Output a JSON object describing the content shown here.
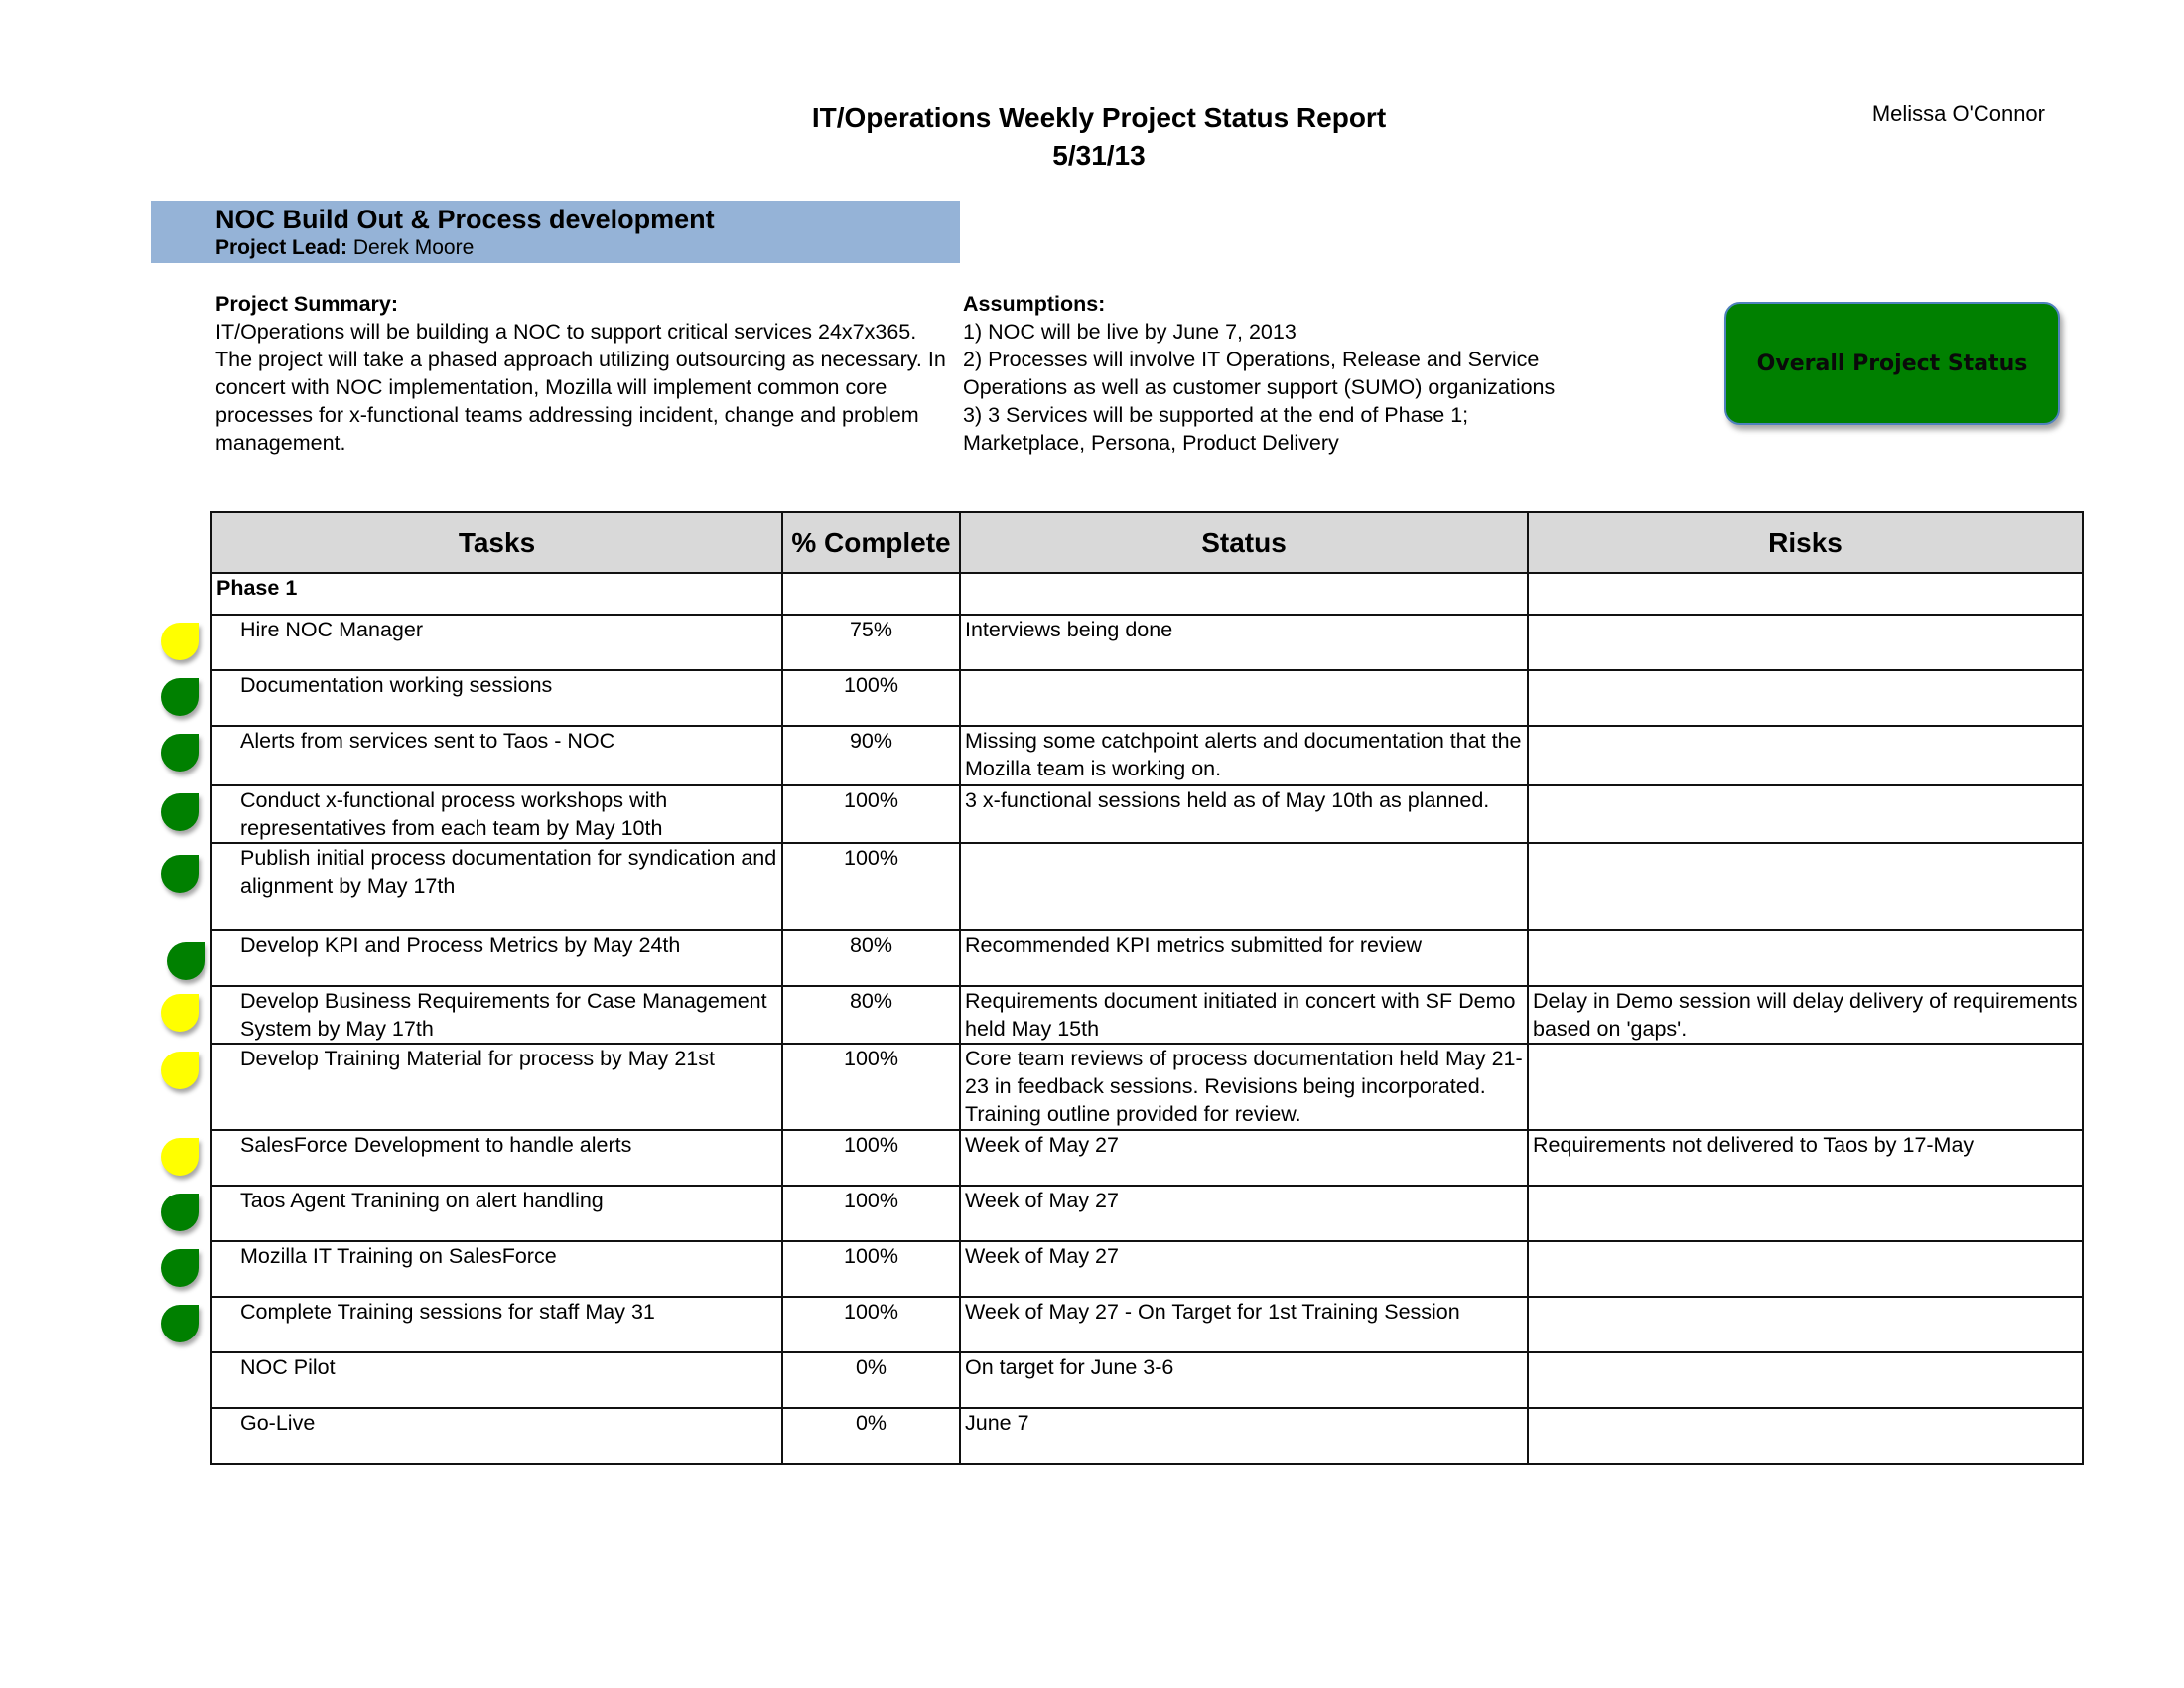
{
  "header": {
    "title": "IT/Operations Weekly Project Status Report",
    "date": "5/31/13",
    "author": "Melissa O'Connor"
  },
  "project": {
    "name": "NOC Build Out & Process development",
    "lead_label": "Project Lead:",
    "lead_name": "Derek Moore"
  },
  "summary": {
    "heading": "Project Summary:",
    "text": "IT/Operations will be building a NOC to support critical services 24x7x365. The project will take a phased approach utilizing outsourcing as necessary.  In concert with NOC implementation, Mozilla will implement common core processes for x-functional teams addressing incident, change and problem management."
  },
  "assumptions": {
    "heading": "Assumptions:",
    "items": [
      "1) NOC will be live by June 7, 2013",
      "2) Processes will involve IT Operations, Release and Service Operations as well as customer support (SUMO) organizations",
      "3) 3 Services will be supported at the end of Phase 1; Marketplace, Persona, Product Delivery"
    ]
  },
  "overall_status": {
    "label": "Overall Project Status",
    "color": "#008000"
  },
  "colors": {
    "green": "#008000",
    "yellow": "#ffff00",
    "header_bg": "#d9d9d9",
    "banner_bg": "#95b3d7"
  },
  "table": {
    "columns": [
      "Tasks",
      "% Complete",
      "Status",
      "Risks"
    ],
    "phase_label": "Phase 1",
    "rows": [
      {
        "task": "Hire NOC Manager",
        "pct": "75%",
        "status": "Interviews being done",
        "risk": "",
        "indicator": "yellow"
      },
      {
        "task": "Documentation working sessions",
        "pct": "100%",
        "status": "",
        "risk": "",
        "indicator": "green"
      },
      {
        "task": "Alerts from services sent to Taos - NOC",
        "pct": "90%",
        "status": "Missing some catchpoint alerts and documentation that the Mozilla team is working on.",
        "risk": "",
        "indicator": "green"
      },
      {
        "task": "Conduct x-functional process workshops with representatives from each team by May 10th",
        "pct": "100%",
        "status": "3 x-functional sessions held as of May 10th as planned.",
        "risk": "",
        "indicator": "green"
      },
      {
        "task": "Publish initial process documentation for syndication and alignment by May 17th",
        "pct": "100%",
        "status": "",
        "risk": "",
        "indicator": "green"
      },
      {
        "task": "Develop KPI and Process Metrics by May 24th",
        "pct": "80%",
        "status": "Recommended KPI metrics submitted for review",
        "risk": "",
        "indicator": "green"
      },
      {
        "task": "Develop Business Requirements for Case Management System by May 17th",
        "pct": "80%",
        "status": "Requirements document initiated in concert with SF Demo held May 15th",
        "risk": "Delay in Demo session will delay delivery of requirements based on 'gaps'.",
        "indicator": "yellow"
      },
      {
        "task": "Develop Training Material for process by May 21st",
        "pct": "100%",
        "status": "Core team reviews of process documentation held May 21-23 in feedback sessions. Revisions being incorporated. Training outline provided for review.",
        "risk": "",
        "indicator": "yellow"
      },
      {
        "task": "SalesForce Development to handle alerts",
        "pct": "100%",
        "status": "Week of May 27",
        "risk": "Requirements not delivered to Taos by 17-May",
        "indicator": "yellow"
      },
      {
        "task": "Taos Agent Tranining on alert handling",
        "pct": "100%",
        "status": "Week of May 27",
        "risk": "",
        "indicator": "green"
      },
      {
        "task": "Mozilla IT Training on SalesForce",
        "pct": "100%",
        "status": "Week of May 27",
        "risk": "",
        "indicator": "green"
      },
      {
        "task": "Complete Training sessions for staff May 31",
        "pct": "100%",
        "status": "Week of May 27  - On Target for 1st Training Session",
        "risk": "",
        "indicator": "green"
      },
      {
        "task": "NOC Pilot",
        "pct": "0%",
        "status": "On target for June 3-6",
        "risk": "",
        "indicator": null
      },
      {
        "task": "Go-Live",
        "pct": "0%",
        "status": "June 7",
        "risk": "",
        "indicator": null
      }
    ]
  }
}
